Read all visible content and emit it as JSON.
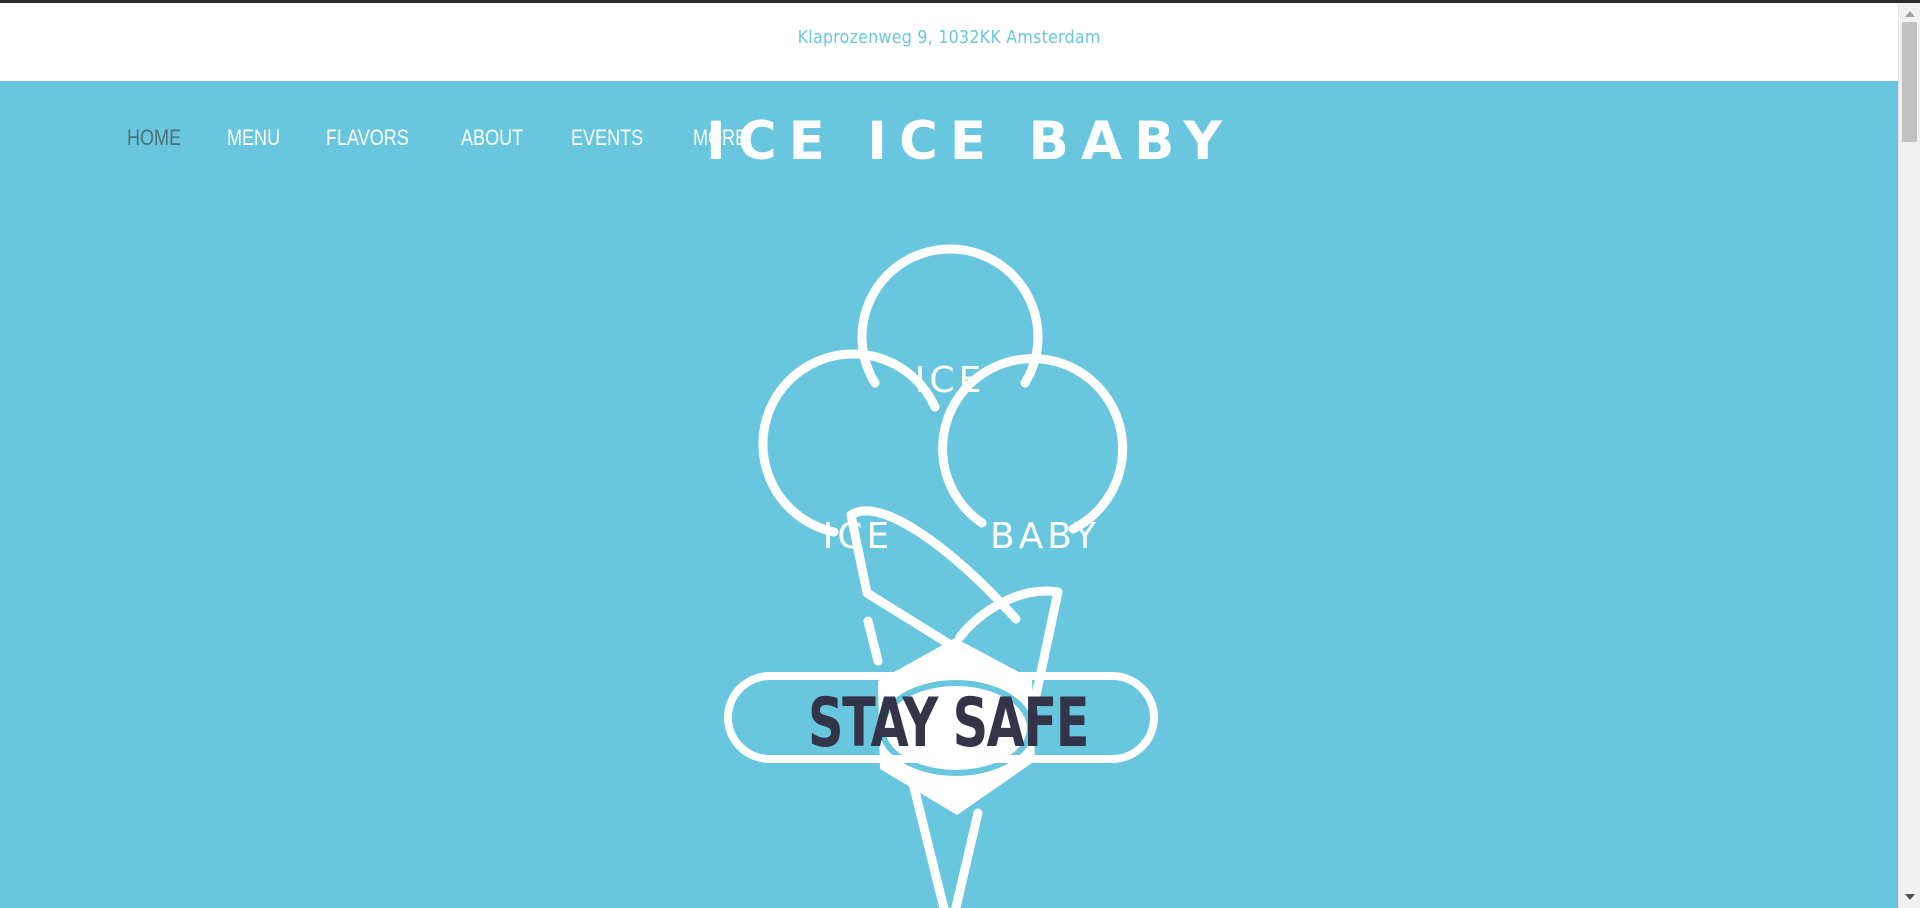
{
  "address": {
    "text": "Klaprozenweg 9, 1032KK Amsterdam"
  },
  "nav": {
    "items": [
      {
        "label": "HOME",
        "active": true
      },
      {
        "label": "MENU",
        "active": false
      },
      {
        "label": "FLAVORS",
        "active": false
      },
      {
        "label": "ABOUT",
        "active": false
      },
      {
        "label": "EVENTS",
        "active": false
      },
      {
        "label": "MORE",
        "active": false
      }
    ]
  },
  "site": {
    "title": "ICE ICE BABY"
  },
  "logo": {
    "scoop_top": "ICE",
    "scoop_left": "ICE",
    "scoop_right": "BABY",
    "banner": "STAY SAFE"
  },
  "colors": {
    "hero_background": "#68c7df",
    "address_text": "#6cc7de",
    "active_nav": "#4f6f7a",
    "banner_text": "#333447",
    "logo_stroke": "#ffffff"
  },
  "icons": {
    "scroll_up": "triangle-up-icon",
    "scroll_down": "triangle-down-icon"
  }
}
